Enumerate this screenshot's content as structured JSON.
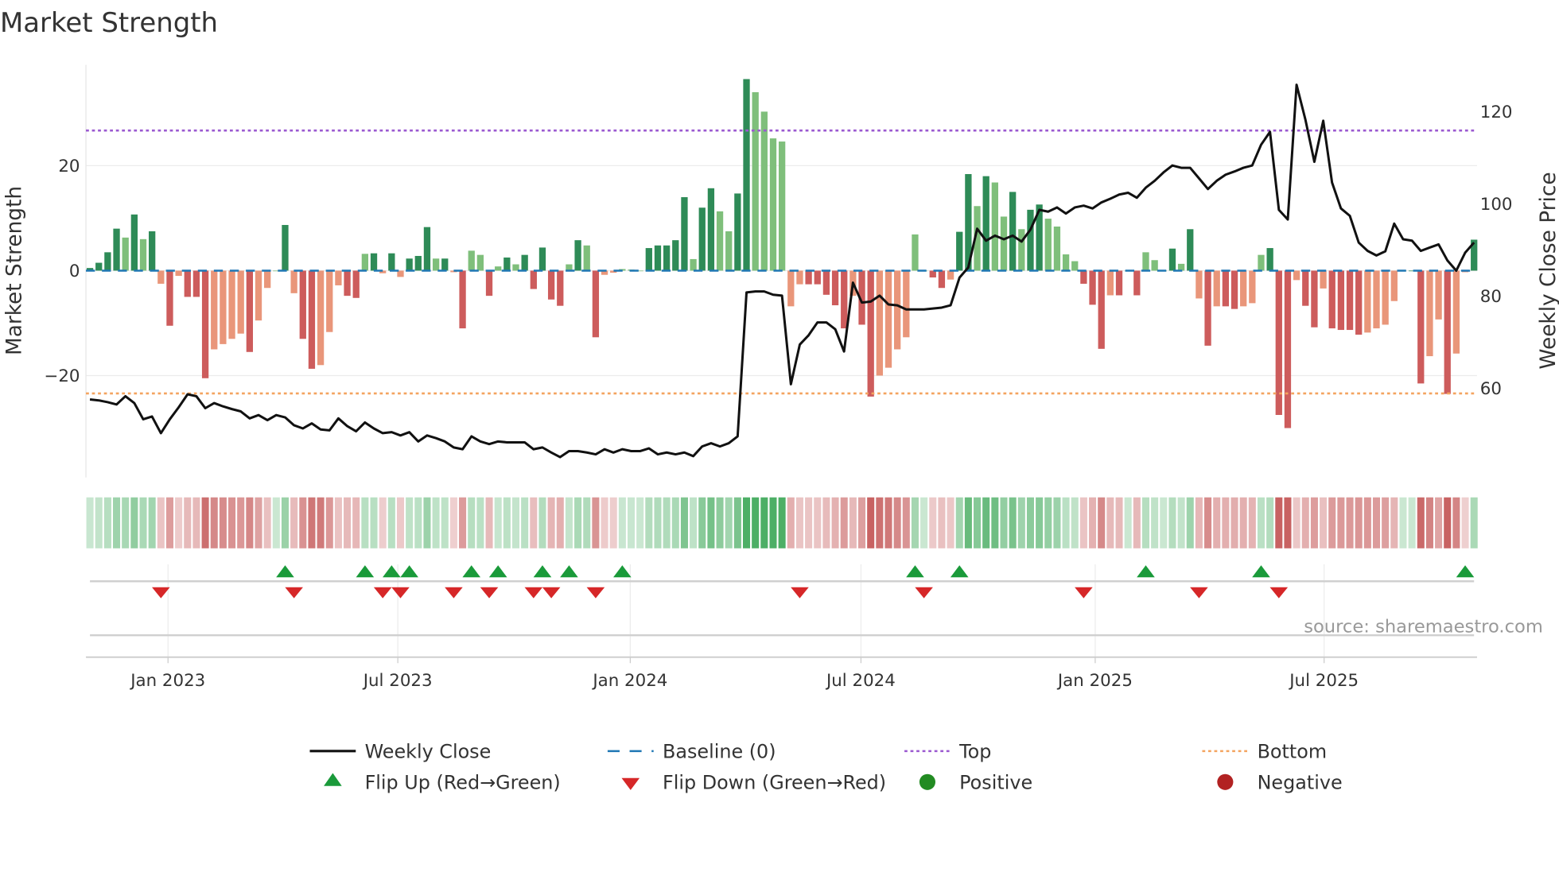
{
  "title": "Market Strength",
  "source": "source: sharemaestro.com",
  "chart_data": {
    "type": "bar",
    "title": "Market Strength",
    "ylabel": "Market Strength",
    "y2label": "Weekly Close Price",
    "ylim": [
      -39.4,
      39.2
    ],
    "y2lim": [
      40.7,
      130.1
    ],
    "yticks": [
      {
        "label": "20",
        "value": 20
      },
      {
        "label": "0",
        "value": 0
      },
      {
        "label": "−20",
        "value": -20
      }
    ],
    "y2ticks": [
      {
        "label": "120",
        "value": 120
      },
      {
        "label": "100",
        "value": 100
      },
      {
        "label": "80",
        "value": 80
      },
      {
        "label": "60",
        "value": 60
      }
    ],
    "xticks": [
      {
        "label": "Jan 2023",
        "week": 8.8
      },
      {
        "label": "Jul 2023",
        "week": 34.7
      },
      {
        "label": "Jan 2024",
        "week": 60.9
      },
      {
        "label": "Jul 2024",
        "week": 86.9
      },
      {
        "label": "Jan 2025",
        "week": 113.3
      },
      {
        "label": "Jul 2025",
        "week": 139.1
      }
    ],
    "top_threshold": 26.7,
    "bottom_threshold": -23.4,
    "baseline": 0,
    "strength": [
      0.5,
      1.5,
      3.5,
      8,
      6.3,
      10.7,
      6,
      7.5,
      -2.5,
      -10.5,
      -1,
      -5,
      -5,
      -20.5,
      -15,
      -14,
      -13,
      -12,
      -15.5,
      -9.5,
      -3.3,
      0,
      8.7,
      -4.3,
      -13,
      -18.7,
      -18,
      -11.7,
      -2.8,
      -4.8,
      -5.2,
      3.2,
      3.3,
      -0.5,
      3.3,
      -1.2,
      2.3,
      2.8,
      8.3,
      2.3,
      2.3,
      -0.3,
      -11,
      3.8,
      3,
      -4.8,
      0.8,
      2.5,
      1.2,
      3,
      -3.5,
      4.4,
      -5.5,
      -6.7,
      1.2,
      5.8,
      4.8,
      -12.7,
      -0.8,
      -0.4,
      0.3,
      0.2,
      0,
      4.3,
      4.8,
      4.8,
      5.8,
      14,
      2.2,
      12,
      15.7,
      11.3,
      7.5,
      14.7,
      36.5,
      34,
      30.3,
      25.2,
      24.6,
      -6.8,
      -2.6,
      -2.6,
      -2.6,
      -4.6,
      -6.6,
      -11,
      -4.8,
      -10.3,
      -24,
      -20,
      -18.5,
      -15,
      -12.7,
      6.9,
      0,
      -1.3,
      -3.3,
      -1.7,
      7.4,
      18.4,
      12.3,
      18,
      16.8,
      10.3,
      15,
      7.9,
      11.6,
      12.6,
      9.9,
      8.4,
      3.1,
      1.8,
      -2.5,
      -6.5,
      -14.9,
      -4.7,
      -4.7,
      0,
      -4.7,
      3.5,
      2,
      0,
      4.2,
      1.3,
      7.9,
      -5.3,
      -14.3,
      -6.8,
      -6.8,
      -7.3,
      -6.8,
      -6.2,
      3,
      4.3,
      -27.5,
      -30,
      -1.8,
      -6.7,
      -10.8,
      -3.4,
      -11,
      -11.3,
      -11.3,
      -12.2,
      -11.8,
      -11,
      -10.3,
      -5.8,
      0,
      0,
      -21.5,
      -16.3,
      -9.3,
      -23.5,
      -15.8,
      -0.3,
      5.9
    ],
    "weekly_close": [
      57.6,
      57.4,
      57.0,
      56.5,
      58.3,
      56.8,
      53.3,
      53.9,
      50.3,
      53.3,
      55.9,
      58.7,
      58.3,
      55.7,
      56.8,
      56.1,
      55.5,
      55.0,
      53.5,
      54.2,
      53.1,
      54.2,
      53.7,
      52.0,
      51.3,
      52.4,
      51.1,
      50.9,
      53.5,
      51.8,
      50.7,
      52.6,
      51.3,
      50.3,
      50.5,
      49.8,
      50.5,
      48.5,
      49.8,
      49.2,
      48.5,
      47.2,
      46.8,
      49.6,
      48.5,
      47.9,
      48.5,
      48.3,
      48.3,
      48.3,
      46.8,
      47.2,
      46.1,
      45.1,
      46.4,
      46.4,
      46.1,
      45.7,
      46.8,
      46.1,
      46.8,
      46.4,
      46.4,
      47.0,
      45.7,
      46.1,
      45.7,
      46.1,
      45.3,
      47.4,
      48.1,
      47.4,
      48.1,
      49.6,
      80.8,
      81.0,
      81.0,
      80.3,
      80.1,
      60.9,
      69.5,
      71.5,
      74.3,
      74.3,
      72.8,
      68.0,
      82.9,
      78.6,
      78.8,
      80.1,
      78.2,
      78.0,
      77.1,
      77.1,
      77.1,
      77.3,
      77.5,
      78.0,
      84.0,
      86.2,
      94.6,
      92.0,
      93.1,
      92.3,
      93.1,
      91.8,
      94.4,
      98.7,
      98.3,
      99.2,
      97.9,
      99.2,
      99.6,
      99.0,
      100.3,
      101.1,
      102.0,
      102.4,
      101.3,
      103.5,
      105.0,
      106.8,
      108.3,
      107.8,
      107.8,
      105.5,
      103.2,
      105.0,
      106.3,
      107.0,
      107.8,
      108.3,
      112.8,
      115.6,
      98.7,
      96.6,
      125.8,
      118.2,
      109.1,
      118.0,
      104.6,
      99.0,
      97.4,
      91.6,
      89.8,
      88.8,
      89.7,
      95.7,
      92.3,
      92.0,
      89.8,
      90.5,
      91.2,
      87.7,
      85.5,
      89.4,
      91.6
    ],
    "flip_up_weeks": [
      22,
      31,
      34,
      36,
      43,
      46,
      51,
      54,
      60,
      93,
      98,
      119,
      132,
      155
    ],
    "flip_down_weeks": [
      8,
      23,
      33,
      35,
      41,
      45,
      50,
      52,
      57,
      80,
      94,
      112,
      125,
      134
    ],
    "colors": {
      "pos_strong": "#2e8b57",
      "pos_weak": "#7fbf7b",
      "neg_strong": "#cd5c5c",
      "neg_weak": "#e9967a",
      "line": "#111111",
      "baseline": "#1f77b4",
      "top": "#9b59d0",
      "bottom": "#f4a460",
      "flip_up": "#1a9a3a",
      "flip_down": "#d62728",
      "positive": "#228b22",
      "negative": "#b22222"
    },
    "legend": [
      {
        "label": "Weekly Close",
        "kind": "line"
      },
      {
        "label": "Baseline (0)",
        "kind": "dash"
      },
      {
        "label": "Top",
        "kind": "dotTop"
      },
      {
        "label": "Bottom",
        "kind": "dotBottom"
      },
      {
        "label": "Flip Up (Red→Green)",
        "kind": "up"
      },
      {
        "label": "Flip Down (Green→Red)",
        "kind": "down"
      },
      {
        "label": "Positive",
        "kind": "pos"
      },
      {
        "label": "Negative",
        "kind": "neg"
      }
    ]
  }
}
